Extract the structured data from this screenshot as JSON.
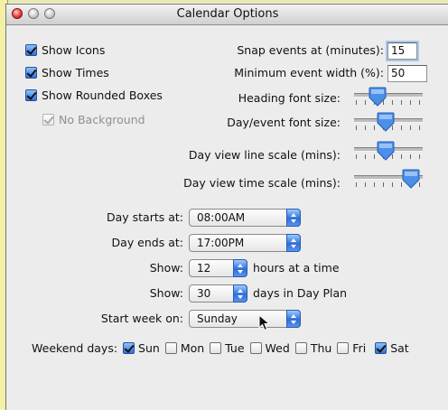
{
  "window": {
    "title": "Calendar Options"
  },
  "checkboxes": {
    "show_icons": {
      "label": "Show Icons",
      "checked": true
    },
    "show_times": {
      "label": "Show Times",
      "checked": true
    },
    "show_rounded": {
      "label": "Show Rounded Boxes",
      "checked": true
    },
    "no_background": {
      "label": "No Background",
      "checked": true,
      "disabled": true
    }
  },
  "fields": {
    "snap": {
      "label": "Snap events at (minutes):",
      "value": "15"
    },
    "min_width": {
      "label": "Minimum event width (%):",
      "value": "50"
    }
  },
  "sliders": {
    "heading_font": {
      "label": "Heading font size:",
      "level": 0.3
    },
    "day_event_font": {
      "label": "Day/event font size:",
      "level": 0.45
    },
    "line_scale": {
      "label": "Day view line scale (mins):",
      "level": 0.45
    },
    "time_scale": {
      "label": "Day view time scale (mins):",
      "level": 0.92
    }
  },
  "popups": {
    "day_starts": {
      "label": "Day starts at:",
      "value": "08:00AM"
    },
    "day_ends": {
      "label": "Day ends at:",
      "value": "17:00PM"
    },
    "hours_show": {
      "label": "Show:",
      "value": "12",
      "suffix": "hours at a time"
    },
    "days_show": {
      "label": "Show:",
      "value": "30",
      "suffix": "days in Day Plan"
    },
    "start_week": {
      "label": "Start week on:",
      "value": "Sunday"
    }
  },
  "weekend": {
    "label": "Weekend days:",
    "days": [
      {
        "name": "Sun",
        "checked": true
      },
      {
        "name": "Mon",
        "checked": false
      },
      {
        "name": "Tue",
        "checked": false
      },
      {
        "name": "Wed",
        "checked": false
      },
      {
        "name": "Thu",
        "checked": false
      },
      {
        "name": "Fri",
        "checked": false
      },
      {
        "name": "Sat",
        "checked": true
      }
    ]
  },
  "colors": {
    "accent": "#2e6fd8",
    "slider_thumb": "#4b8fe8"
  }
}
